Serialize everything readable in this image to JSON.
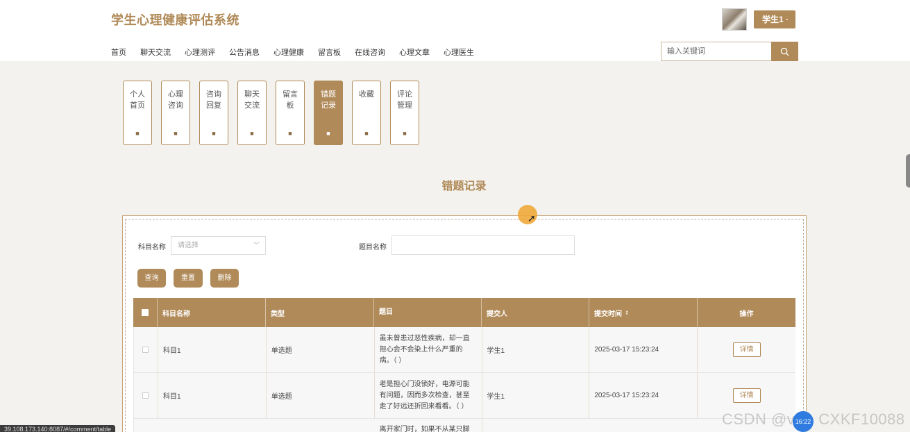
{
  "app": {
    "title": "学生心理健康评估系统"
  },
  "user": {
    "name": "学生1 ·"
  },
  "nav": [
    "首页",
    "聊天交流",
    "心理测评",
    "公告消息",
    "心理健康",
    "留言板",
    "在线咨询",
    "心理文章",
    "心理医生"
  ],
  "search": {
    "placeholder": "输入关键词"
  },
  "tiles": [
    {
      "label": "个人首页",
      "active": false
    },
    {
      "label": "心理咨询",
      "active": false
    },
    {
      "label": "咨询回复",
      "active": false
    },
    {
      "label": "聊天交流",
      "active": false
    },
    {
      "label": "留言板",
      "active": false
    },
    {
      "label": "错题记录",
      "active": true
    },
    {
      "label": "收藏",
      "active": false
    },
    {
      "label": "评论管理",
      "active": false
    }
  ],
  "page_title": "错题记录",
  "filters": {
    "subject_label": "科目名称",
    "subject_placeholder": "请选择",
    "question_label": "题目名称"
  },
  "buttons": {
    "query": "查询",
    "reset": "重置",
    "delete": "删除"
  },
  "table": {
    "headers": [
      "科目名称",
      "类型",
      "题目",
      "提交人",
      "提交时间",
      "操作"
    ],
    "rows": [
      {
        "subject": "科目1",
        "type": "单选题",
        "question": "虽未曾患过恶性疾病，却一直担心会不会染上什么严重的病。（ ）",
        "user": "学生1",
        "time": "2025-03-17 15:23:24",
        "action": "详情"
      },
      {
        "subject": "科目1",
        "type": "单选题",
        "question": "老是担心门没锁好，电源可能有问题，因而多次检查，甚至走了好远还折回来看看。（ ）",
        "user": "学生1",
        "time": "2025-03-17 15:23:24",
        "action": "详情"
      },
      {
        "subject": "",
        "type": "",
        "question": "离开家门时，如果不从某只脚开",
        "user": "",
        "time": "",
        "action": ""
      }
    ]
  },
  "status_url": "39.108.173.140:8087/#/comment/table",
  "watermark": "CSDN @vx：CXKF10088",
  "badge": "16:22",
  "colors": {
    "accent": "#b08a58",
    "background": "#f3f2ee"
  }
}
